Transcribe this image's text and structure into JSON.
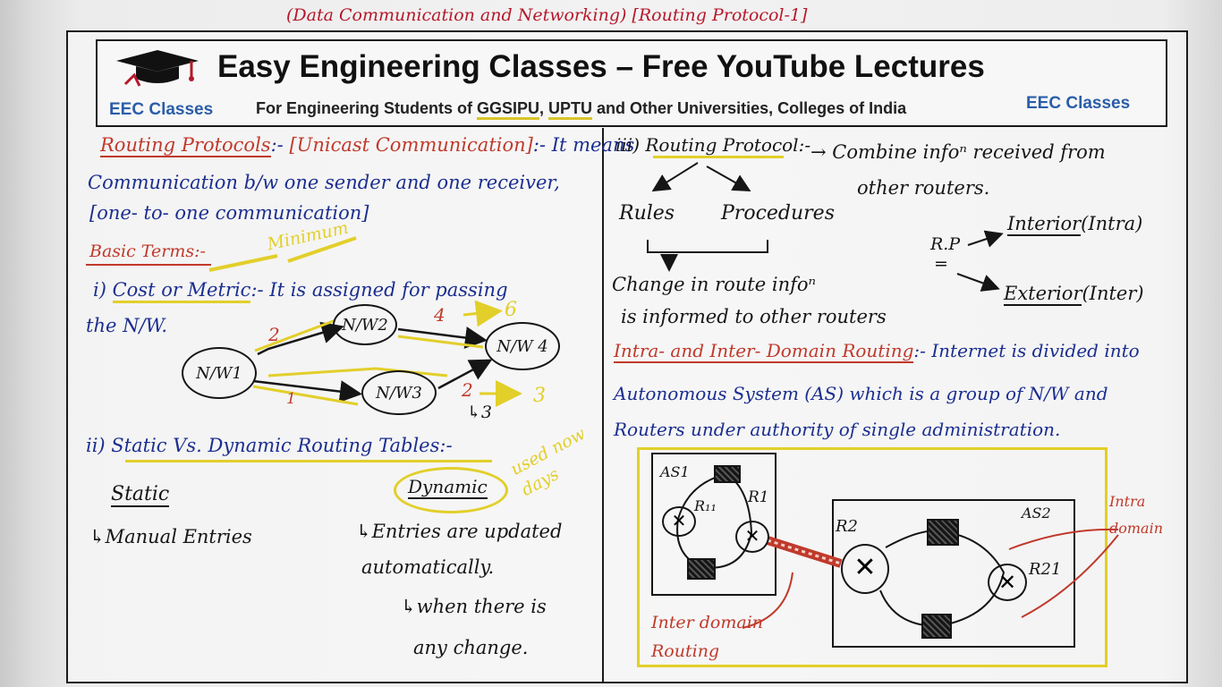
{
  "caption": "(Data Communication and Networking) [Routing Protocol-1]",
  "header": {
    "title": "Easy Engineering Classes – Free YouTube Lectures",
    "eec_left": "EEC Classes",
    "eec_right": "EEC Classes",
    "sub_part1": "For Engineering Students of ",
    "sub_ggsipu": "GGSIPU",
    "sub_comma": ", ",
    "sub_uptu": "UPTU",
    "sub_part2": " and Other Universities, Colleges of India"
  },
  "left": {
    "routing_protocols": "Routing Protocols",
    "colon_sep": ":-",
    "unicast": "[Unicast Communication]",
    "it_means": ":- It means",
    "line2": "Communication b/w one sender and one receiver,",
    "line3": "[one- to- one communication]",
    "basic_terms": "Basic Terms:-",
    "minimum": "Minimum",
    "cost_prefix": "i) ",
    "cost_metric": "Cost or Metric",
    "cost_rest": ":- It is assigned for passing",
    "the_nw": "the N/W.",
    "graph": {
      "nodes": [
        "N/W1",
        "N/W2",
        "N/W3",
        "N/W 4"
      ],
      "edge_nw1_nw2": "2",
      "edge_nw2_nw4": "4",
      "edge_nw2_nw4_total": "6",
      "edge_nw1_nw3": "1",
      "edge_nw3_nw4": "2",
      "edge_nw3_nw4_total": "3",
      "edge_nw3_nw4_sub": "↳3"
    },
    "static_dynamic_title": "ii) Static Vs. Dynamic Routing Tables:-",
    "used_nowdays": "used now days",
    "static": "Static",
    "static_entries": "↳Manual Entries",
    "dynamic": "Dynamic",
    "dyn_line1": "↳Entries are updated",
    "dyn_line2": "automatically.",
    "dyn_line3": "↳when there is",
    "dyn_line4": "any change."
  },
  "right": {
    "rp_title": "iii) Routing Protocol:-",
    "rp_desc1": "→ Combine infoⁿ received from",
    "rp_desc2": "other routers.",
    "rules": "Rules",
    "procedures": "Procedures",
    "change_line1": "Change in route infoⁿ",
    "change_line2": "is informed to other routers",
    "rp_short": "R.P",
    "rp_eq": "=",
    "interior": "Interior",
    "interior_note": "(Intra)",
    "exterior": "Exterior",
    "exterior_note": "(Inter)",
    "domain_title": "Intra- and Inter- Domain Routing",
    "domain_rest": ":- Internet is divided into",
    "domain_line2": "Autonomous System (AS) which is a group of N/W and",
    "domain_line3": "Routers under authority of single administration.",
    "as1": "AS1",
    "as2": "AS2",
    "r11": "R₁₁",
    "r1": "R1",
    "r2": "R2",
    "r21": "R21",
    "inter_domain": "Inter domain Routing",
    "intra_domain": "Intra domain"
  },
  "colors": {
    "ink_blue": "#1b2e8f",
    "ink_red": "#c0392b",
    "ink_black": "#151515",
    "highlighter_yellow": "#e2cf2a",
    "brand_blue": "#2a5da8"
  }
}
